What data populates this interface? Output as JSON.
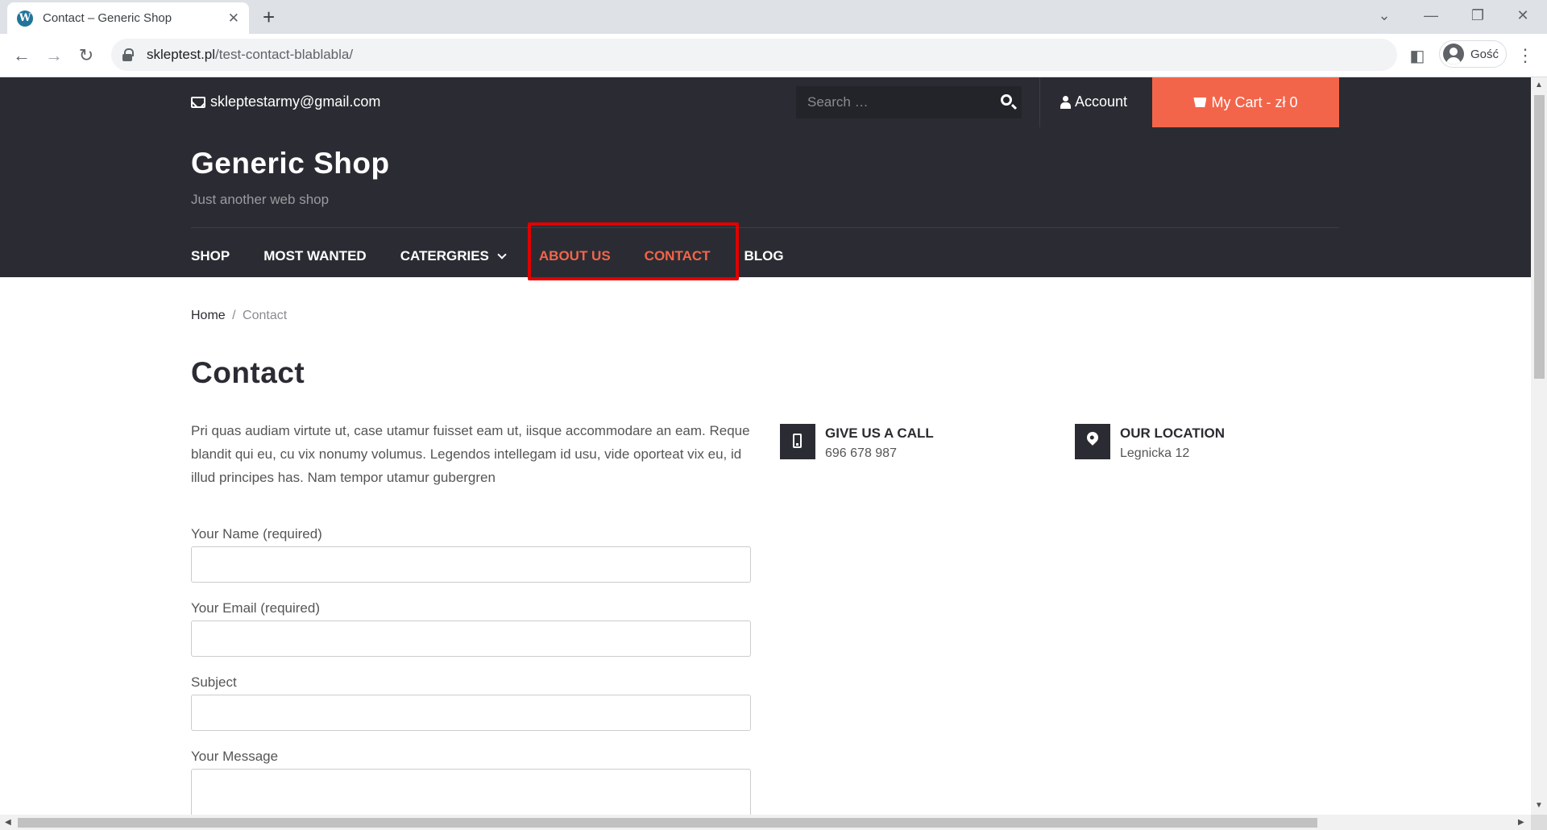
{
  "browser": {
    "tab_title": "Contact – Generic Shop",
    "tab_close": "✕",
    "new_tab": "+",
    "url_host": "skleptest.pl",
    "url_path": "/test-contact-blablabla/",
    "profile_label": "Gość",
    "back": "←",
    "forward": "→",
    "reload": "↻",
    "win_minimize": "—",
    "win_restore": "❐",
    "win_close": "✕",
    "tab_search": "⌄",
    "menu_dots": "⋮",
    "sidepanel": "◧"
  },
  "topbar": {
    "email": "skleptestarmy@gmail.com",
    "search_placeholder": "Search …",
    "account": "Account",
    "cart": "My Cart - zł 0"
  },
  "header": {
    "site_title": "Generic Shop",
    "tagline": "Just another web shop",
    "menu": [
      "SHOP",
      "MOST WANTED",
      "CATERGRIES",
      "ABOUT US",
      "CONTACT",
      "BLOG"
    ]
  },
  "breadcrumb": {
    "home": "Home",
    "separator": "/",
    "current": "Contact"
  },
  "content": {
    "title": "Contact",
    "intro": "Pri quas audiam virtute ut, case utamur fuisset eam ut, iisque accommodare an eam. Reque blandit qui eu, cu vix nonumy volumus. Legendos intellegam id usu, vide oporteat vix eu, id illud principes has. Nam tempor utamur gubergren",
    "call_title": "GIVE US A CALL",
    "call_value": "696 678 987",
    "location_title": "OUR LOCATION",
    "location_value": "Legnicka 12"
  },
  "form": {
    "name_label": "Your Name (required)",
    "email_label": "Your Email (required)",
    "subject_label": "Subject",
    "message_label": "Your Message"
  },
  "colors": {
    "dark": "#2b2c33",
    "accent": "#f3654a",
    "highlight_box": "#e00000"
  }
}
